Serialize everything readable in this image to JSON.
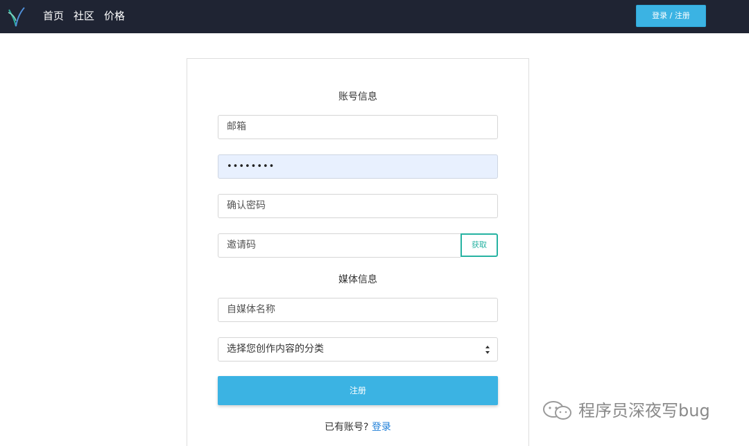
{
  "nav": {
    "links": [
      "首页",
      "社区",
      "价格"
    ],
    "auth_button": "登录 / 注册"
  },
  "form": {
    "account_title": "账号信息",
    "email_placeholder": "邮箱",
    "password_value": "••••••••",
    "confirm_placeholder": "确认密码",
    "invite_placeholder": "邀请码",
    "get_button": "获取",
    "media_title": "媒体信息",
    "media_name_placeholder": "自媒体名称",
    "category_selected": "选择您创作内容的分类",
    "submit_button": "注册",
    "has_account_text": "已有账号?",
    "login_link": "登录"
  },
  "watermark": {
    "text": "程序员深夜写bug"
  },
  "colors": {
    "navbar": "#1f2433",
    "primary": "#3bb3e3",
    "accent_green": "#25b2a1",
    "link": "#1f7fd8"
  }
}
